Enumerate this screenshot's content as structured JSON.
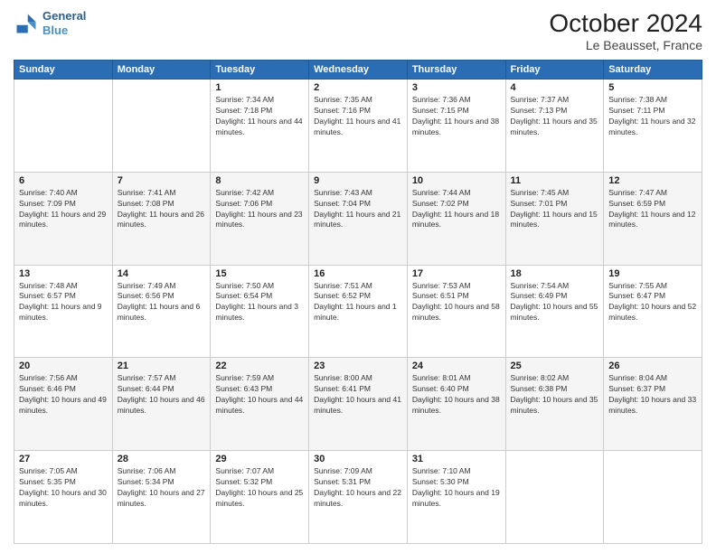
{
  "header": {
    "logo_line1": "General",
    "logo_line2": "Blue",
    "month_title": "October 2024",
    "location": "Le Beausset, France"
  },
  "weekdays": [
    "Sunday",
    "Monday",
    "Tuesday",
    "Wednesday",
    "Thursday",
    "Friday",
    "Saturday"
  ],
  "weeks": [
    [
      {
        "day": "",
        "info": ""
      },
      {
        "day": "",
        "info": ""
      },
      {
        "day": "1",
        "info": "Sunrise: 7:34 AM\nSunset: 7:18 PM\nDaylight: 11 hours and 44 minutes."
      },
      {
        "day": "2",
        "info": "Sunrise: 7:35 AM\nSunset: 7:16 PM\nDaylight: 11 hours and 41 minutes."
      },
      {
        "day": "3",
        "info": "Sunrise: 7:36 AM\nSunset: 7:15 PM\nDaylight: 11 hours and 38 minutes."
      },
      {
        "day": "4",
        "info": "Sunrise: 7:37 AM\nSunset: 7:13 PM\nDaylight: 11 hours and 35 minutes."
      },
      {
        "day": "5",
        "info": "Sunrise: 7:38 AM\nSunset: 7:11 PM\nDaylight: 11 hours and 32 minutes."
      }
    ],
    [
      {
        "day": "6",
        "info": "Sunrise: 7:40 AM\nSunset: 7:09 PM\nDaylight: 11 hours and 29 minutes."
      },
      {
        "day": "7",
        "info": "Sunrise: 7:41 AM\nSunset: 7:08 PM\nDaylight: 11 hours and 26 minutes."
      },
      {
        "day": "8",
        "info": "Sunrise: 7:42 AM\nSunset: 7:06 PM\nDaylight: 11 hours and 23 minutes."
      },
      {
        "day": "9",
        "info": "Sunrise: 7:43 AM\nSunset: 7:04 PM\nDaylight: 11 hours and 21 minutes."
      },
      {
        "day": "10",
        "info": "Sunrise: 7:44 AM\nSunset: 7:02 PM\nDaylight: 11 hours and 18 minutes."
      },
      {
        "day": "11",
        "info": "Sunrise: 7:45 AM\nSunset: 7:01 PM\nDaylight: 11 hours and 15 minutes."
      },
      {
        "day": "12",
        "info": "Sunrise: 7:47 AM\nSunset: 6:59 PM\nDaylight: 11 hours and 12 minutes."
      }
    ],
    [
      {
        "day": "13",
        "info": "Sunrise: 7:48 AM\nSunset: 6:57 PM\nDaylight: 11 hours and 9 minutes."
      },
      {
        "day": "14",
        "info": "Sunrise: 7:49 AM\nSunset: 6:56 PM\nDaylight: 11 hours and 6 minutes."
      },
      {
        "day": "15",
        "info": "Sunrise: 7:50 AM\nSunset: 6:54 PM\nDaylight: 11 hours and 3 minutes."
      },
      {
        "day": "16",
        "info": "Sunrise: 7:51 AM\nSunset: 6:52 PM\nDaylight: 11 hours and 1 minute."
      },
      {
        "day": "17",
        "info": "Sunrise: 7:53 AM\nSunset: 6:51 PM\nDaylight: 10 hours and 58 minutes."
      },
      {
        "day": "18",
        "info": "Sunrise: 7:54 AM\nSunset: 6:49 PM\nDaylight: 10 hours and 55 minutes."
      },
      {
        "day": "19",
        "info": "Sunrise: 7:55 AM\nSunset: 6:47 PM\nDaylight: 10 hours and 52 minutes."
      }
    ],
    [
      {
        "day": "20",
        "info": "Sunrise: 7:56 AM\nSunset: 6:46 PM\nDaylight: 10 hours and 49 minutes."
      },
      {
        "day": "21",
        "info": "Sunrise: 7:57 AM\nSunset: 6:44 PM\nDaylight: 10 hours and 46 minutes."
      },
      {
        "day": "22",
        "info": "Sunrise: 7:59 AM\nSunset: 6:43 PM\nDaylight: 10 hours and 44 minutes."
      },
      {
        "day": "23",
        "info": "Sunrise: 8:00 AM\nSunset: 6:41 PM\nDaylight: 10 hours and 41 minutes."
      },
      {
        "day": "24",
        "info": "Sunrise: 8:01 AM\nSunset: 6:40 PM\nDaylight: 10 hours and 38 minutes."
      },
      {
        "day": "25",
        "info": "Sunrise: 8:02 AM\nSunset: 6:38 PM\nDaylight: 10 hours and 35 minutes."
      },
      {
        "day": "26",
        "info": "Sunrise: 8:04 AM\nSunset: 6:37 PM\nDaylight: 10 hours and 33 minutes."
      }
    ],
    [
      {
        "day": "27",
        "info": "Sunrise: 7:05 AM\nSunset: 5:35 PM\nDaylight: 10 hours and 30 minutes."
      },
      {
        "day": "28",
        "info": "Sunrise: 7:06 AM\nSunset: 5:34 PM\nDaylight: 10 hours and 27 minutes."
      },
      {
        "day": "29",
        "info": "Sunrise: 7:07 AM\nSunset: 5:32 PM\nDaylight: 10 hours and 25 minutes."
      },
      {
        "day": "30",
        "info": "Sunrise: 7:09 AM\nSunset: 5:31 PM\nDaylight: 10 hours and 22 minutes."
      },
      {
        "day": "31",
        "info": "Sunrise: 7:10 AM\nSunset: 5:30 PM\nDaylight: 10 hours and 19 minutes."
      },
      {
        "day": "",
        "info": ""
      },
      {
        "day": "",
        "info": ""
      }
    ]
  ]
}
